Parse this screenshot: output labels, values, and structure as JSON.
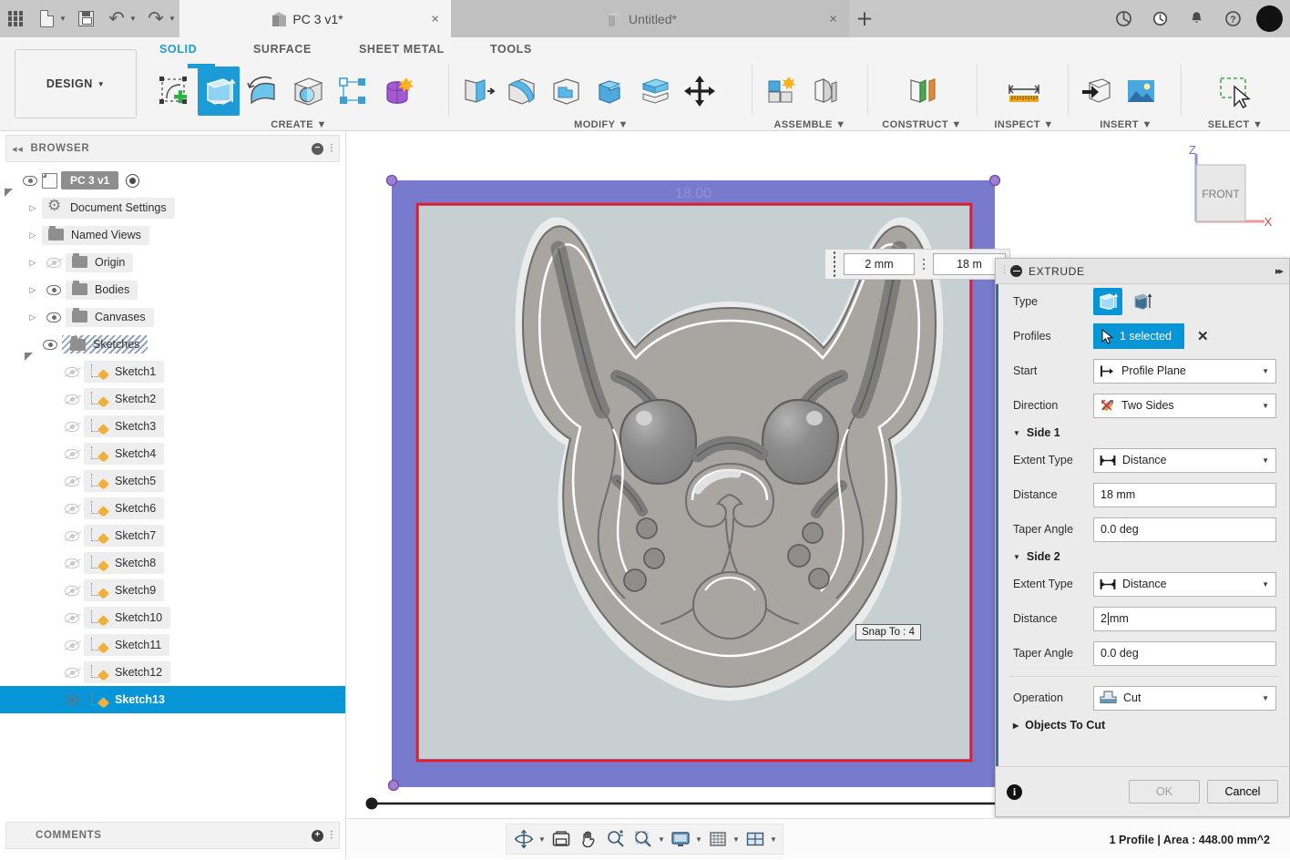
{
  "titlebar": {
    "icons": [
      "app-grid-icon",
      "new-document-icon",
      "save-icon",
      "undo-icon",
      "redo-icon"
    ],
    "tabs": [
      {
        "label": "PC 3 v1*",
        "active": true,
        "close": "×"
      },
      {
        "label": "Untitled*",
        "active": false,
        "close": "×"
      }
    ],
    "new_tab": "+",
    "right_icons": [
      "extensions-icon",
      "recent-icon",
      "notifications-icon",
      "help-icon"
    ],
    "avatar": "user-avatar"
  },
  "ribbon": {
    "workspace": "DESIGN",
    "workspace_caret": "▼",
    "tabs": [
      {
        "label": "SOLID",
        "selected": true
      },
      {
        "label": "SURFACE",
        "selected": false
      },
      {
        "label": "SHEET METAL",
        "selected": false
      },
      {
        "label": "TOOLS",
        "selected": false
      }
    ],
    "groups": [
      {
        "label": "CREATE ▼",
        "name": "create"
      },
      {
        "label": "MODIFY ▼",
        "name": "modify"
      },
      {
        "label": "ASSEMBLE ▼",
        "name": "assemble"
      },
      {
        "label": "CONSTRUCT ▼",
        "name": "construct"
      },
      {
        "label": "INSPECT ▼",
        "name": "inspect"
      },
      {
        "label": "INSERT ▼",
        "name": "insert"
      },
      {
        "label": "SELECT ▼",
        "name": "select"
      }
    ]
  },
  "browser": {
    "header": "BROWSER",
    "collapse_icon": "◂◂",
    "minimize": "−",
    "root": {
      "label": "PC 3 v1",
      "visible": true
    },
    "nodes": [
      {
        "label": "Document Settings",
        "icon": "gear-icon",
        "eye": "none"
      },
      {
        "label": "Named Views",
        "icon": "folder-icon",
        "eye": "none"
      },
      {
        "label": "Origin",
        "icon": "folder-icon",
        "eye": "hidden"
      },
      {
        "label": "Bodies",
        "icon": "folder-icon",
        "eye": "visible"
      },
      {
        "label": "Canvases",
        "icon": "folder-icon",
        "eye": "visible"
      },
      {
        "label": "Sketches",
        "icon": "folder-icon",
        "eye": "visible",
        "expanded": true
      }
    ],
    "sketches": [
      {
        "label": "Sketch1",
        "visible": false
      },
      {
        "label": "Sketch2",
        "visible": false
      },
      {
        "label": "Sketch3",
        "visible": false
      },
      {
        "label": "Sketch4",
        "visible": false
      },
      {
        "label": "Sketch5",
        "visible": false
      },
      {
        "label": "Sketch6",
        "visible": false
      },
      {
        "label": "Sketch7",
        "visible": false
      },
      {
        "label": "Sketch8",
        "visible": false
      },
      {
        "label": "Sketch9",
        "visible": false
      },
      {
        "label": "Sketch10",
        "visible": false
      },
      {
        "label": "Sketch11",
        "visible": false
      },
      {
        "label": "Sketch12",
        "visible": false
      },
      {
        "label": "Sketch13",
        "visible": true,
        "selected": true
      }
    ]
  },
  "comments": {
    "header": "COMMENTS",
    "add": "+"
  },
  "canvas": {
    "dimension_label": "18.00",
    "snap_tooltip": "Snap To : 4",
    "dim_toolbar": {
      "field1": "2 mm",
      "field2": "18 m"
    },
    "viewcube": {
      "face": "FRONT",
      "axis_z": "Z",
      "axis_x": "X"
    },
    "accent_blue": "#6c6fc9",
    "accent_red": "#f01818"
  },
  "extrude": {
    "title": "EXTRUDE",
    "expand": "▸▸",
    "type_label": "Type",
    "profiles_label": "Profiles",
    "profiles_value": "1 selected",
    "profiles_clear": "✕",
    "start_label": "Start",
    "start_value": "Profile Plane",
    "direction_label": "Direction",
    "direction_value": "Two Sides",
    "side1_label": "Side 1",
    "side1": {
      "extent_label": "Extent Type",
      "extent_value": "Distance",
      "distance_label": "Distance",
      "distance_value": "18 mm",
      "taper_label": "Taper Angle",
      "taper_value": "0.0 deg"
    },
    "side2_label": "Side 2",
    "side2": {
      "extent_label": "Extent Type",
      "extent_value": "Distance",
      "distance_label": "Distance",
      "distance_value": "2",
      "distance_unit": "mm",
      "taper_label": "Taper Angle",
      "taper_value": "0.0 deg"
    },
    "operation_label": "Operation",
    "operation_value": "Cut",
    "objects_label": "Objects To Cut",
    "ok": "OK",
    "cancel": "Cancel",
    "accent": "#0696d7"
  },
  "statusbar": {
    "text": "1 Profile | Area : 448.00 mm^2",
    "nav_icons": [
      "orbit-icon",
      "look-at-icon",
      "pan-icon",
      "zoom-icon",
      "zoom-window-icon",
      "display-settings-icon",
      "grid-snap-icon",
      "viewports-icon"
    ]
  }
}
